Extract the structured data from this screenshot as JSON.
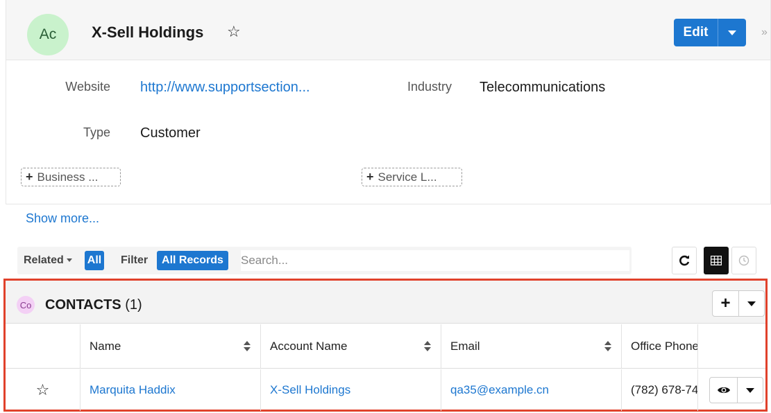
{
  "record": {
    "avatar_initials": "Ac",
    "title": "X-Sell Holdings",
    "edit_label": "Edit",
    "collapse_glyph": "»"
  },
  "fields": {
    "website_label": "Website",
    "website_value": "http://www.supportsection...",
    "industry_label": "Industry",
    "industry_value": "Telecommunications",
    "type_label": "Type",
    "type_value": "Customer",
    "business_btn": "Business ...",
    "service_btn": "Service L..."
  },
  "show_more": "Show more...",
  "filter_bar": {
    "related_label": "Related",
    "related_pill": "All",
    "filter_label": "Filter",
    "filter_pill": "All Records",
    "search_placeholder": "Search..."
  },
  "subpanel": {
    "avatar_initials": "Co",
    "title": "CONTACTS",
    "count": "(1)",
    "add_glyph": "+",
    "columns": [
      "Name",
      "Account Name",
      "Email",
      "Office Phone"
    ],
    "rows": [
      {
        "name": "Marquita Haddix",
        "account_name": "X-Sell Holdings",
        "email": "qa35@example.cn",
        "office_phone": "(782) 678-74"
      }
    ]
  },
  "icons": [
    "star-icon",
    "caret-down-icon",
    "refresh-icon",
    "grid-icon",
    "clock-icon",
    "plus-icon",
    "eye-icon",
    "sort-icon"
  ],
  "colors": {
    "accent": "#1d77d0",
    "highlight_border": "#e0412b",
    "account_avatar": "#c9f2cc",
    "contact_avatar": "#f3d0f5"
  }
}
